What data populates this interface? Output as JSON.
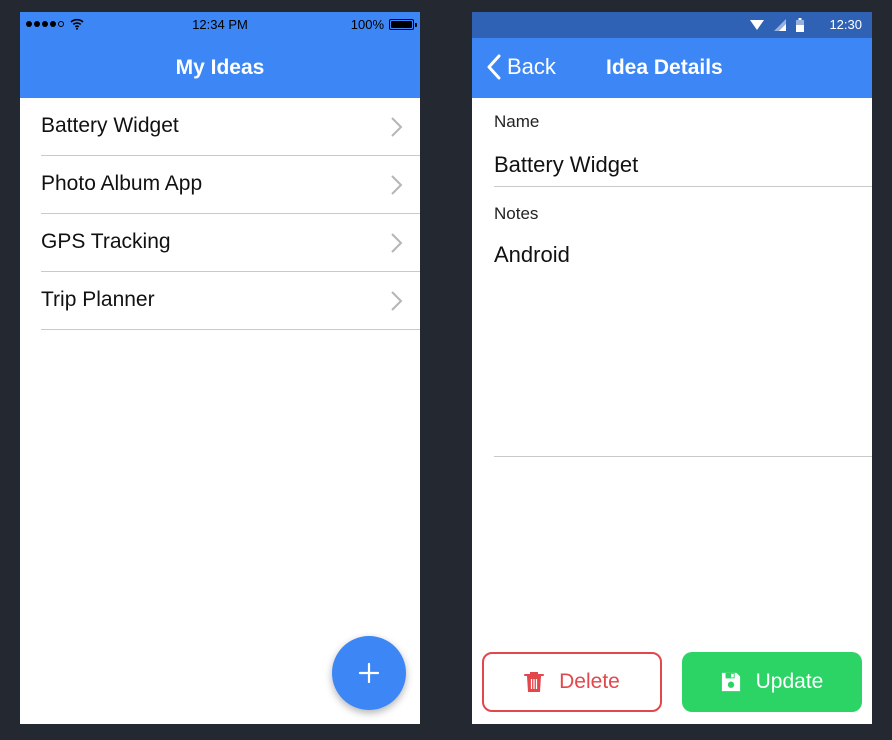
{
  "ios": {
    "status": {
      "time": "12:34 PM",
      "battery": "100%"
    },
    "title": "My Ideas",
    "ideas": [
      {
        "label": "Battery Widget"
      },
      {
        "label": "Photo Album App"
      },
      {
        "label": "GPS Tracking"
      },
      {
        "label": "Trip Planner"
      }
    ]
  },
  "android": {
    "status": {
      "time": "12:30"
    },
    "back_label": "Back",
    "title": "Idea Details",
    "name_label": "Name",
    "name_value": "Battery Widget",
    "notes_label": "Notes",
    "notes_value": "Android",
    "delete_label": "Delete",
    "update_label": "Update"
  },
  "colors": {
    "accent": "#3d86f6",
    "android_status": "#2f62b5",
    "delete": "#e2474c",
    "update": "#2cd465",
    "background": "#232831"
  },
  "icons": [
    "wifi-icon",
    "battery-icon",
    "chevron-right-icon",
    "plus-icon",
    "back-chevron-icon",
    "trash-icon",
    "save-icon",
    "signal-icon"
  ]
}
